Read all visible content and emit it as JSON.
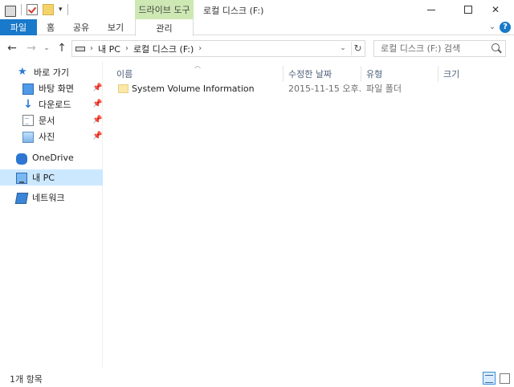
{
  "titlebar": {
    "context_tab_label": "드라이브 도구",
    "window_title": "로컬 디스크 (F:)"
  },
  "ribbon": {
    "tabs": [
      {
        "label": "파일"
      },
      {
        "label": "홈"
      },
      {
        "label": "공유"
      },
      {
        "label": "보기"
      },
      {
        "label": "관리"
      }
    ]
  },
  "address": {
    "segments": [
      "내 PC",
      "로컬 디스크 (F:)"
    ],
    "search_placeholder": "로컬 디스크 (F:) 검색"
  },
  "navpane": {
    "items": [
      {
        "label": "바로 가기",
        "icon": "star-icon"
      },
      {
        "label": "바탕 화면",
        "icon": "desktop-icon",
        "pinned": true
      },
      {
        "label": "다운로드",
        "icon": "download-icon",
        "pinned": true
      },
      {
        "label": "문서",
        "icon": "document-icon",
        "pinned": true
      },
      {
        "label": "사진",
        "icon": "pictures-icon",
        "pinned": true
      },
      {
        "label": "OneDrive",
        "icon": "onedrive-icon"
      },
      {
        "label": "내 PC",
        "icon": "this-pc-icon",
        "selected": true
      },
      {
        "label": "네트워크",
        "icon": "network-icon"
      }
    ]
  },
  "content": {
    "columns": [
      "이름",
      "수정한 날짜",
      "유형",
      "크기"
    ],
    "rows": [
      {
        "name": "System Volume Information",
        "date": "2015-11-15 오후...",
        "type": "파일 폴더",
        "size": ""
      }
    ]
  },
  "status": {
    "item_count": "1개 항목"
  },
  "colors": {
    "file_tab_bg": "#1979ca",
    "context_tab_bg": "#cde8b3",
    "selected_nav_bg": "#cce8ff"
  }
}
